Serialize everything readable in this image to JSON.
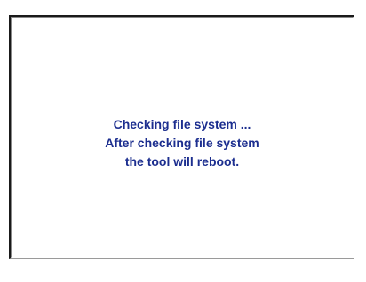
{
  "dialog": {
    "lines": [
      "Checking file system ...",
      "After checking file system",
      "the tool will reboot."
    ]
  },
  "colors": {
    "text": "#1c2e8f",
    "background": "#ffffff",
    "border_dark": "#1a1a1a"
  }
}
